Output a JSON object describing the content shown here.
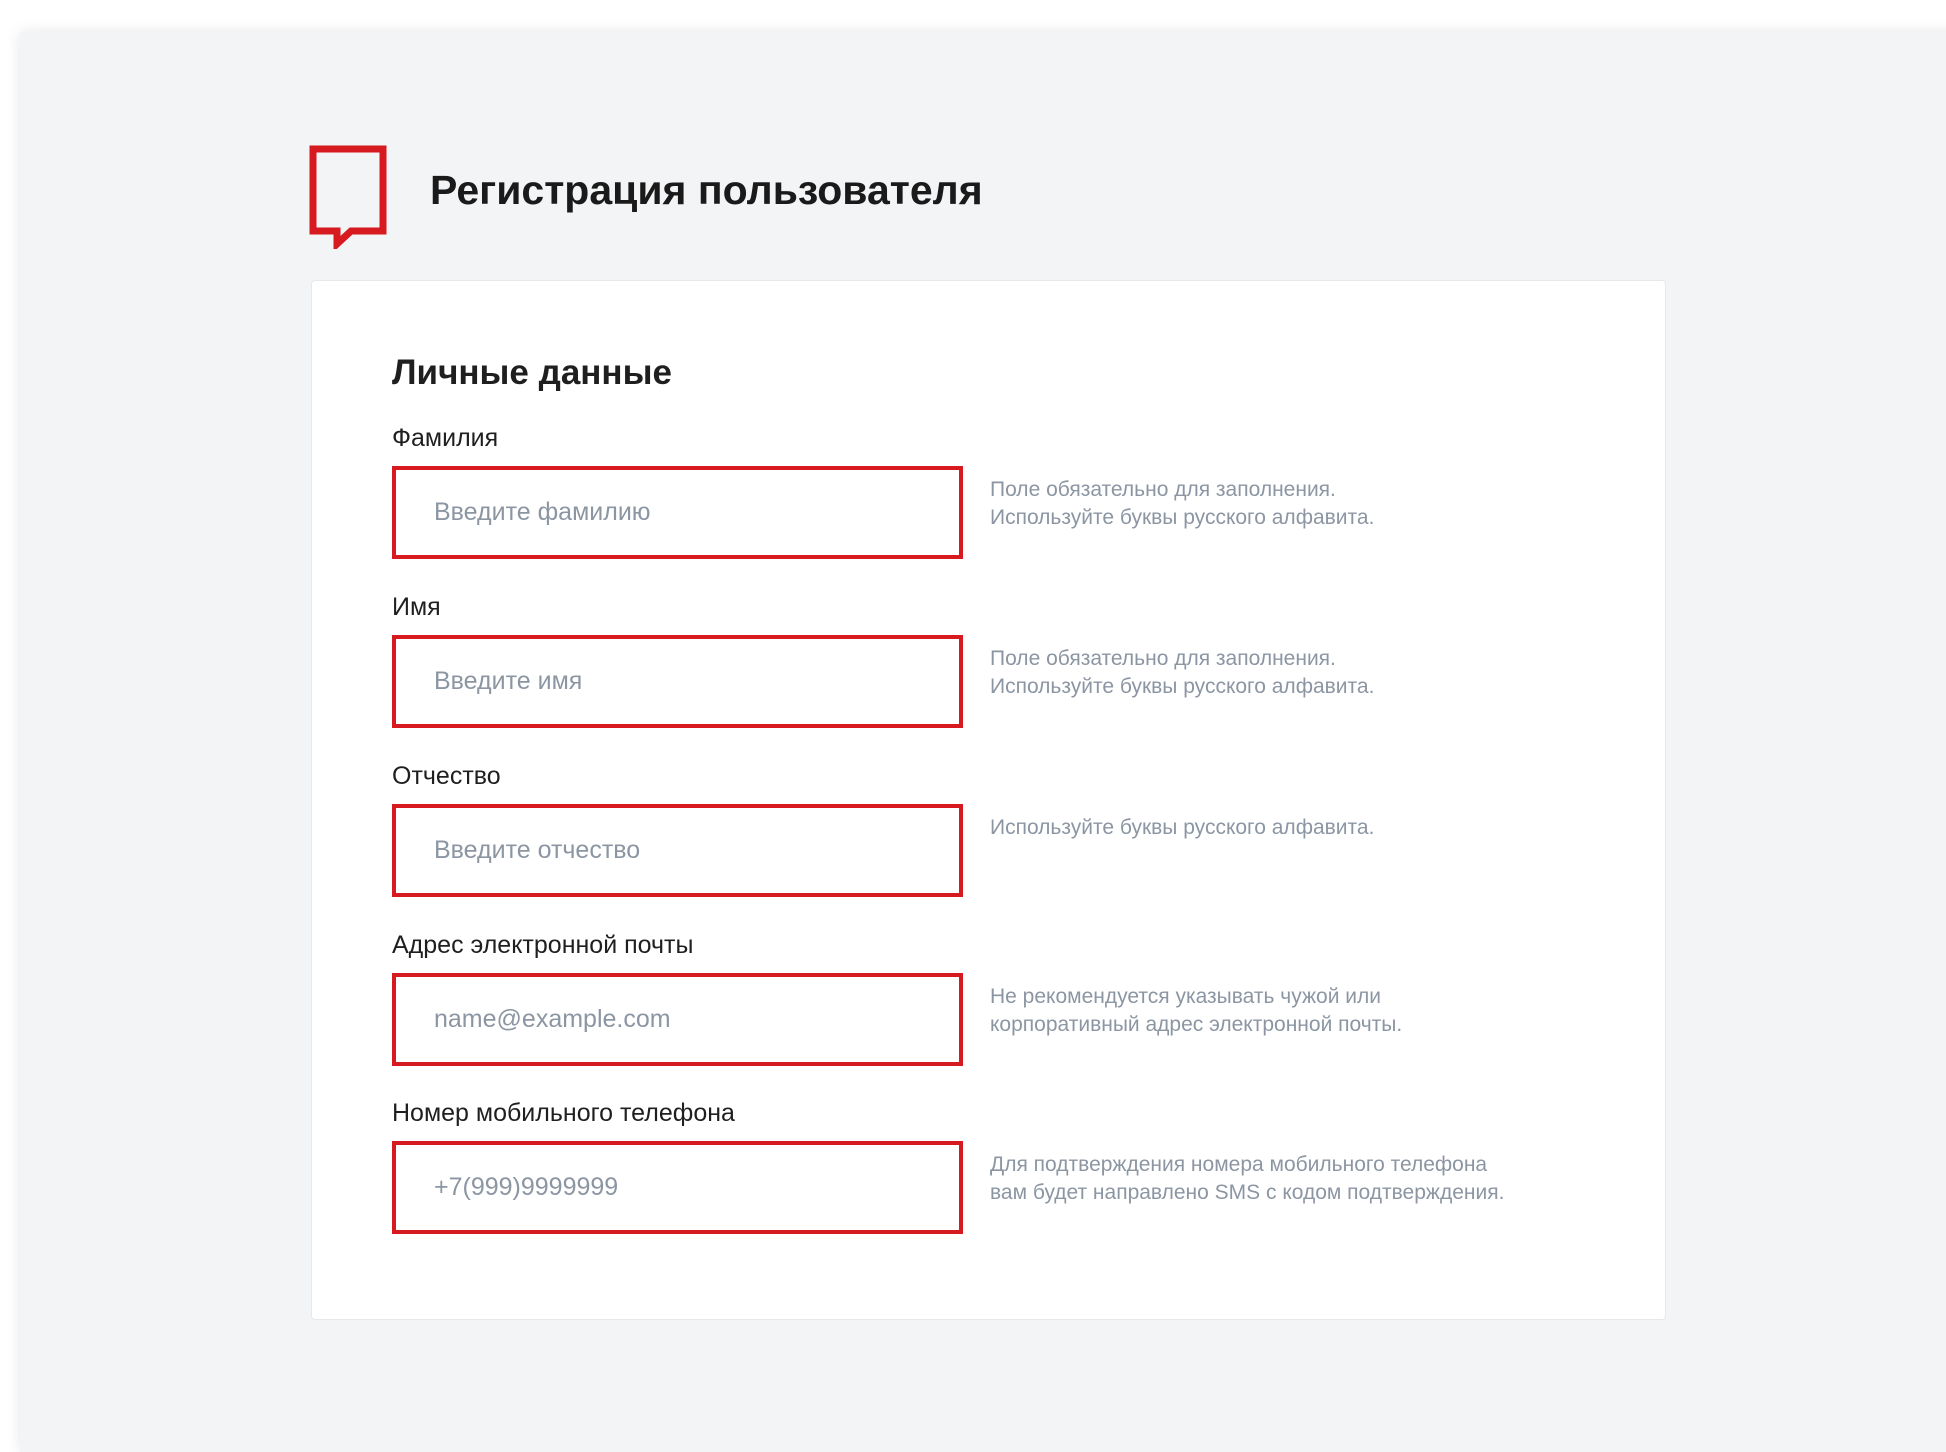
{
  "header": {
    "logo_icon": "speech-bubble-logo-icon",
    "title": "Регистрация пользователя"
  },
  "form": {
    "section_title": "Личные данные",
    "fields": [
      {
        "label": "Фамилия",
        "placeholder": "Введите фамилию",
        "value": "",
        "hint": [
          "Поле обязательно для заполнения.",
          "Используйте буквы русского алфавита."
        ]
      },
      {
        "label": "Имя",
        "placeholder": "Введите имя",
        "value": "",
        "hint": [
          "Поле обязательно для заполнения.",
          "Используйте буквы русского алфавита."
        ]
      },
      {
        "label": "Отчество",
        "placeholder": "Введите отчество",
        "value": "",
        "hint": [
          "Используйте буквы русского алфавита."
        ]
      },
      {
        "label": "Адрес электронной почты",
        "placeholder": "name@example.com",
        "value": "",
        "hint": [
          "Не рекомендуется указывать чужой или",
          "корпоративный адрес электронной почты."
        ]
      },
      {
        "label": "Номер мобильного телефона",
        "placeholder": "+7(999)9999999",
        "value": "",
        "hint": [
          "Для подтверждения номера мобильного телефона",
          "вам будет направлено SMS с кодом подтверждения."
        ]
      }
    ]
  },
  "colors": {
    "accent": "#d71920",
    "page_background": "#f3f4f6",
    "card_background": "#ffffff",
    "hint_text": "#8c96a3",
    "heading_text": "#1a1a1a"
  }
}
